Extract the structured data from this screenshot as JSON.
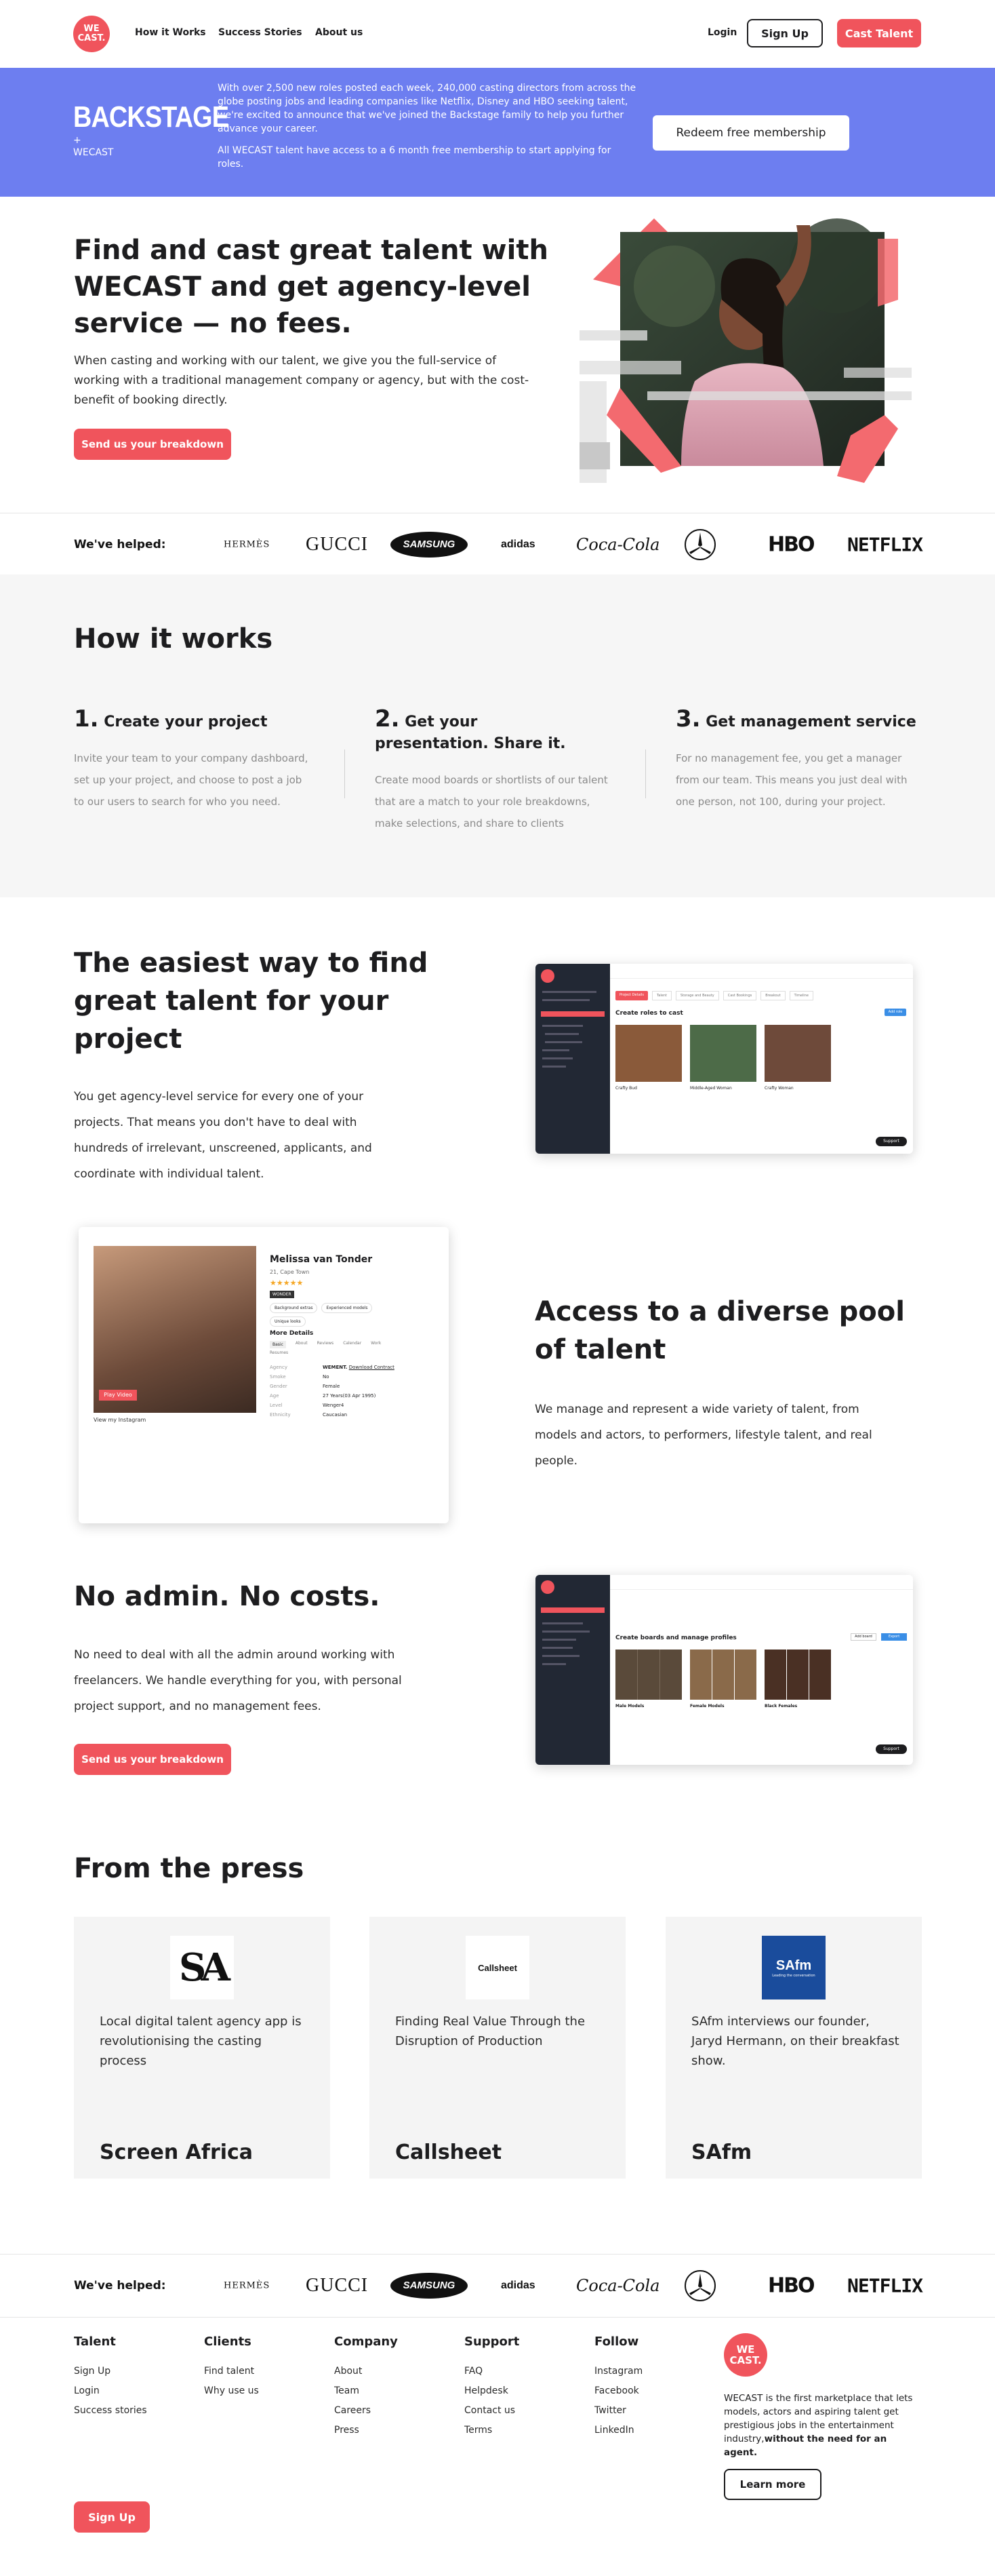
{
  "header": {
    "logo_text_1": "WE",
    "logo_text_2": "CAST.",
    "nav": [
      "How it Works",
      "Success Stories",
      "About us"
    ],
    "login": "Login",
    "signup": "Sign Up",
    "cast_talent": "Cast Talent"
  },
  "banner": {
    "logo": "BACKSTAGE",
    "logo_plus": "+",
    "logo_sub": "WECAST",
    "text_1": "With over 2,500 new roles posted each week, 240,000 casting directors from across the globe posting jobs and leading companies like Netflix, Disney and HBO seeking talent, we're excited to announce that we've joined the Backstage family to help you further advance your career.",
    "text_2": "All WECAST talent have access to a 6 month free membership to start applying for roles.",
    "cta": "Redeem free membership"
  },
  "hero": {
    "title": "Find and cast great talent with WECAST and get agency-level service — no fees.",
    "text": "When casting and working with our talent, we give you the full-service of working with a traditional management company or agency, but with the cost-benefit of booking directly.",
    "cta": "Send us your breakdown"
  },
  "brands": {
    "label": "We've helped:",
    "items": [
      "HERMÈS",
      "GUCCI",
      "SAMSUNG",
      "adidas",
      "Coca-Cola",
      "Mercedes",
      "HBO",
      "NETFLIX"
    ]
  },
  "how": {
    "title": "How it works",
    "steps": [
      {
        "num": "1.",
        "title": "Create your project",
        "text": "Invite your team to your company dashboard, set up your project, and choose to post a job to our users to search for who you need."
      },
      {
        "num": "2.",
        "title": "Get your presentation. Share it.",
        "text": "Create mood boards or shortlists of our talent that are a match to your role breakdowns, make selections, and share to clients"
      },
      {
        "num": "3.",
        "title": "Get management service",
        "text": "For no management fee, you get a manager from our team. This means you just deal with one person, not 100, during your project."
      }
    ]
  },
  "feature1": {
    "title": "The easiest way to find great talent for your project",
    "text": "You get agency-level service for every one of your projects. That means you don't have to deal with hundreds of irrelevant, unscreened, applicants, and coordinate with individual talent.",
    "shot": {
      "heading": "Create roles to cast",
      "button": "Add role",
      "tabs": [
        "Project Details",
        "Talent",
        "Storage and Beauty",
        "Cast Bookings",
        "Breakout",
        "Timeline"
      ],
      "roles": [
        "Crafty Bud",
        "Middle-Aged Woman",
        "Crafty Woman"
      ],
      "help": "Support"
    }
  },
  "feature2": {
    "title": "Access to a diverse pool of talent",
    "text": "We manage and represent a wide variety of talent, from models and actors, to performers, lifestyle talent, and real people.",
    "card": {
      "name": "Melissa van Tonder",
      "meta": "21, Cape Town",
      "rating": "★★★★★",
      "badge": "WONDER",
      "tags": [
        "Background extras",
        "Experienced models",
        "Unique looks"
      ],
      "section": "More Details",
      "tabs": [
        "Basic",
        "About",
        "Reviews",
        "Calendar",
        "Work",
        "Resumes"
      ],
      "details": [
        {
          "k": "Agency",
          "v": "WEMENT.",
          "v2": "Download Contract"
        },
        {
          "k": "Smoke",
          "v": "No"
        },
        {
          "k": "Gender",
          "v": "Female"
        },
        {
          "k": "Age",
          "v": "27 Years(03 Apr 1995)"
        },
        {
          "k": "Level",
          "v": "Wenger4"
        },
        {
          "k": "Ethnicity",
          "v": "Caucasian"
        }
      ],
      "play": "Play Video",
      "instagram": "View my Instagram"
    }
  },
  "feature3": {
    "title": "No admin. No costs.",
    "text": "No need to deal with all the admin around working with freelancers. We handle everything for you, with personal project support, and no management fees.",
    "cta": "Send us your breakdown",
    "shot": {
      "heading": "Create boards and manage profiles",
      "buttons": [
        "Add board",
        "Export"
      ],
      "boards": [
        "Male Models",
        "Female Models",
        "Black Females"
      ]
    }
  },
  "press": {
    "title": "From the press",
    "items": [
      {
        "logo": "SA",
        "text": "Local digital talent agency app is revolutionising the casting process",
        "name": "Screen Africa"
      },
      {
        "logo": "Callsheet",
        "text": "Finding Real Value Through the Disruption of Production",
        "name": "Callsheet"
      },
      {
        "logo": "SAfm",
        "logo_sub": "Leading the conversation",
        "text": "SAfm interviews our founder, Jaryd Hermann, on their breakfast show.",
        "name": "SAfm"
      }
    ]
  },
  "footer": {
    "cols": [
      {
        "title": "Talent",
        "links": [
          "Sign Up",
          "Login",
          "Success stories"
        ]
      },
      {
        "title": "Clients",
        "links": [
          "Find talent",
          "Why use us"
        ]
      },
      {
        "title": "Company",
        "links": [
          "About",
          "Team",
          "Careers",
          "Press"
        ]
      },
      {
        "title": "Support",
        "links": [
          "FAQ",
          "Helpdesk",
          "Contact us",
          "Terms"
        ]
      },
      {
        "title": "Follow",
        "links": [
          "Instagram",
          "Facebook",
          "Twitter",
          "LinkedIn"
        ]
      }
    ],
    "logo_1": "WE",
    "logo_2": "CAST.",
    "about": "WECAST is the first marketplace that lets models, actors and aspiring talent get prestigious jobs in the entertainment industry,",
    "about_bold": "without the need for an agent.",
    "learn_more": "Learn more",
    "signup": "Sign Up"
  },
  "colors": {
    "accent": "#f0545c",
    "banner": "#6d7ef0",
    "dark": "#1d1d1f",
    "gray_bg": "#f6f6f6"
  }
}
